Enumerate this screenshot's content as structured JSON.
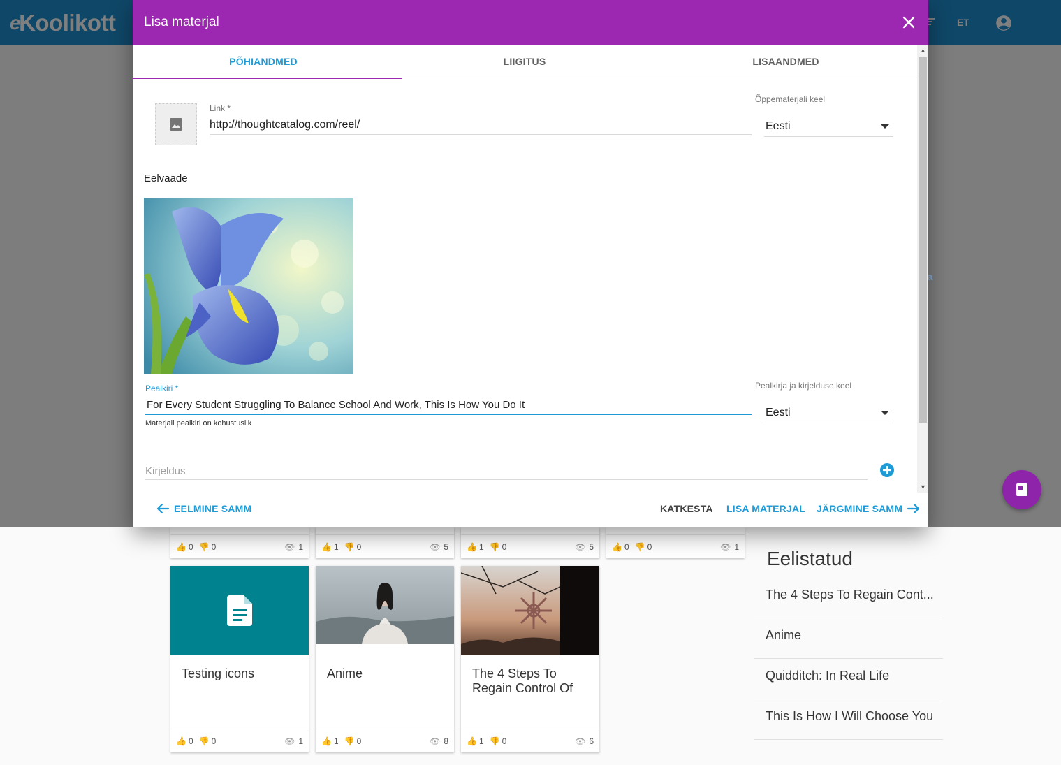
{
  "app": {
    "logo_text": "Koolikott",
    "logo_prefix": "e",
    "language": "ET"
  },
  "dialog": {
    "title": "Lisa materjal",
    "tabs": [
      {
        "label": "PÕHIANDMED",
        "active": true
      },
      {
        "label": "LIIGITUS",
        "active": false
      },
      {
        "label": "LISAANDMED",
        "active": false
      }
    ],
    "link": {
      "label": "Link *",
      "value": "http://thoughtcatalog.com/reel/"
    },
    "material_language": {
      "label": "Õppematerjali keel",
      "value": "Eesti"
    },
    "preview_label": "Eelvaade",
    "title_field": {
      "label": "Pealkiri *",
      "value": "For Every Student Struggling To Balance School And Work, This Is How You Do It",
      "hint": "Materjali pealkiri on kohustuslik"
    },
    "title_language": {
      "label": "Pealkirja ja kirjelduse keel",
      "value": "Eesti"
    },
    "description": {
      "placeholder": "Kirjeldus"
    },
    "buttons": {
      "prev": "EELMINE SAMM",
      "cancel": "KATKESTA",
      "add": "LISA MATERJAL",
      "next": "JÄRGMINE SAMM"
    }
  },
  "background": {
    "partial_text": "ta",
    "top_card_stats": [
      {
        "likes": "0",
        "dislikes": "0",
        "views": "1"
      },
      {
        "likes": "1",
        "dislikes": "0",
        "views": "5"
      },
      {
        "likes": "1",
        "dislikes": "0",
        "views": "5"
      },
      {
        "likes": "0",
        "dislikes": "0",
        "views": "1"
      }
    ],
    "cards": [
      {
        "title": "Testing icons",
        "likes": "0",
        "dislikes": "0",
        "views": "1"
      },
      {
        "title": "Anime",
        "likes": "1",
        "dislikes": "0",
        "views": "8"
      },
      {
        "title": "The 4 Steps To Regain Control Of",
        "likes": "1",
        "dislikes": "0",
        "views": "6"
      }
    ],
    "favorites": {
      "title": "Eelistatud",
      "items": [
        "The 4 Steps To Regain Cont...",
        "Anime",
        "Quidditch: In Real Life",
        "This Is How I Will Choose You"
      ]
    }
  },
  "colors": {
    "header_blue": "#1f8fd1",
    "dialog_purple": "#9c27b0",
    "accent_blue": "#1e9bd7",
    "card_teal": "#00838f"
  }
}
